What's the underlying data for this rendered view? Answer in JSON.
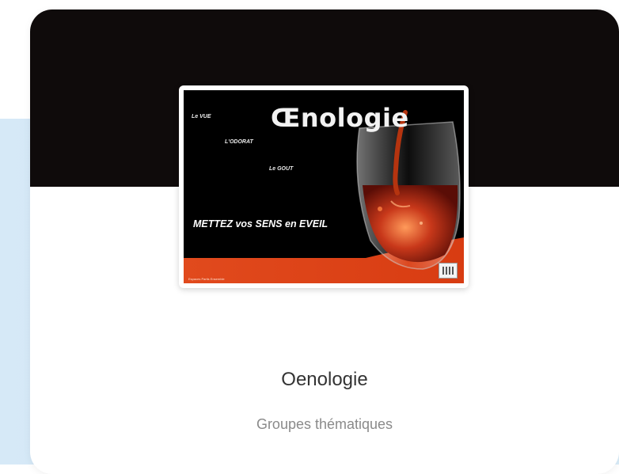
{
  "poster": {
    "title": "Œnologie",
    "line1": "Le VUE",
    "line2": "L'ODORAT",
    "line3": "Le GOUT",
    "tagline": "METTEZ vos SENS en EVEIL",
    "footer": "Espaces Partis Ensemble",
    "icon": "wine-glass-icon"
  },
  "card": {
    "title": "Oenologie",
    "subtitle": "Groupes thématiques"
  },
  "colors": {
    "header_bg": "#0f0b0b",
    "page_bg": "#d6e9f7",
    "poster_band": "#e0461b"
  }
}
